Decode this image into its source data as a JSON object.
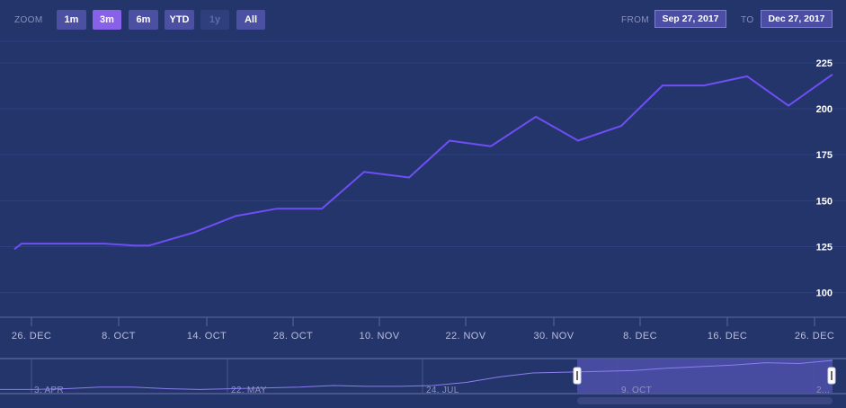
{
  "toolbar": {
    "zoom_label": "ZOOM",
    "zoom_buttons": [
      {
        "label": "1m",
        "state": "normal"
      },
      {
        "label": "3m",
        "state": "active"
      },
      {
        "label": "6m",
        "state": "normal"
      },
      {
        "label": "YTD",
        "state": "normal"
      },
      {
        "label": "1y",
        "state": "disabled"
      },
      {
        "label": "All",
        "state": "normal"
      }
    ],
    "from_label": "FROM",
    "from_value": "Sep 27, 2017",
    "to_label": "TO",
    "to_value": "Dec 27, 2017"
  },
  "colors": {
    "background": "#24356b",
    "line": "#6f4ef5",
    "navigator_fill": "#4d4fa6",
    "active_button": "#8761e8"
  },
  "chart_data": {
    "type": "line",
    "title": "",
    "xlabel": "",
    "ylabel": "",
    "ylim": [
      93,
      243
    ],
    "grid": true,
    "y_ticks": [
      "100",
      "125",
      "150",
      "175",
      "200",
      "225"
    ],
    "x_ticks": [
      "26. DEC",
      "8. OCT",
      "14. OCT",
      "28. OCT",
      "10. NOV",
      "22. NOV",
      "30. NOV",
      "8. DEC",
      "16. DEC",
      "26. DEC"
    ],
    "series": [
      {
        "values": [
          130,
          133,
          133,
          133,
          132,
          132,
          139,
          148,
          152,
          152,
          172,
          169,
          189,
          186,
          202,
          189,
          197,
          219,
          219,
          224,
          208,
          225
        ]
      }
    ]
  },
  "navigator": {
    "tick_labels": [
      "3. APR",
      "22. MAY",
      "24. JUL",
      "9. OCT",
      "2..."
    ],
    "values": [
      3,
      3,
      4,
      6,
      6,
      4,
      3,
      4,
      5,
      6,
      8,
      7,
      7,
      8,
      12,
      19,
      24,
      25,
      26,
      27,
      30,
      32,
      34,
      37,
      36,
      40
    ]
  }
}
